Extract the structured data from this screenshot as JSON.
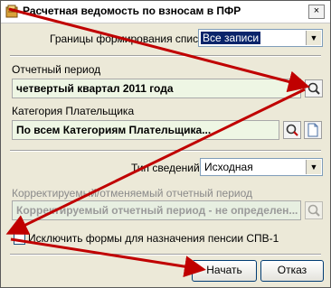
{
  "window": {
    "title": "Расчетная ведомость по взносам в ПФР",
    "close_label": "×"
  },
  "list_bounds": {
    "label": "Границы формирования списка:",
    "value": "Все записи"
  },
  "report_period": {
    "label": "Отчетный период",
    "value": "четвертый квартал 2011 года"
  },
  "payer_category": {
    "label": "Категория Плательщика",
    "value": "По всем Категориям Плательщика..."
  },
  "info_type": {
    "label": "Тип сведений:",
    "value": "Исходная"
  },
  "corrected_period": {
    "label": "Корректируемый/отменяемый отчетный период",
    "value": "Корректируемый отчетный период - не определен..."
  },
  "exclude_forms": {
    "label": "Исключить формы для назначения пенсии СПВ-1",
    "checked": false
  },
  "buttons": {
    "start": "Начать",
    "cancel": "Отказ"
  },
  "colors": {
    "arrow": "#c00000",
    "selection": "#0a246a",
    "field_bg": "#eef6e4"
  }
}
